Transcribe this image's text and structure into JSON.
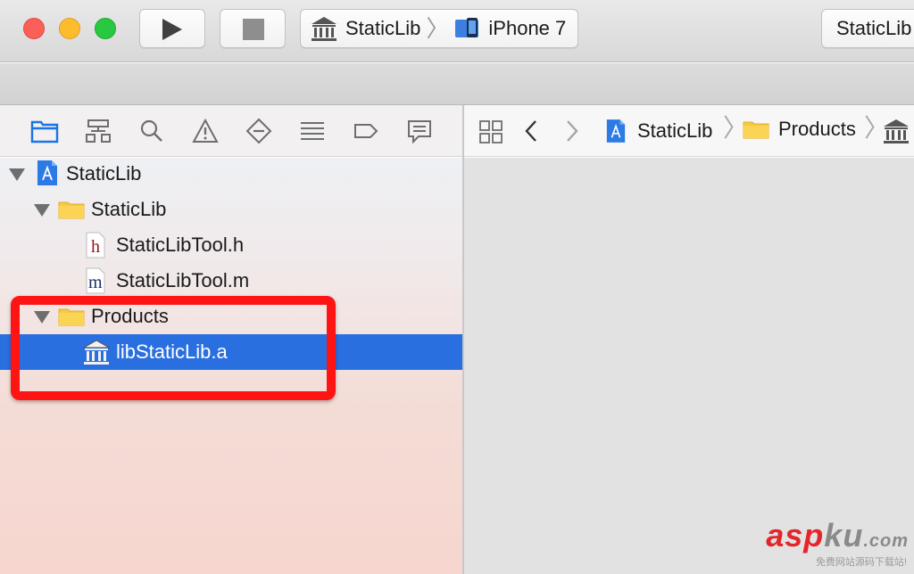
{
  "toolbar": {
    "scheme": "StaticLib",
    "device": "iPhone 7",
    "activity": "StaticLib"
  },
  "navigator_tabs": [
    {
      "name": "project-navigator-icon",
      "active": true
    },
    {
      "name": "symbol-navigator-icon"
    },
    {
      "name": "find-navigator-icon"
    },
    {
      "name": "issue-navigator-icon"
    },
    {
      "name": "test-navigator-icon"
    },
    {
      "name": "debug-navigator-icon"
    },
    {
      "name": "breakpoint-navigator-icon"
    },
    {
      "name": "report-navigator-icon"
    }
  ],
  "tree": {
    "project": "StaticLib",
    "group": "StaticLib",
    "header_file": "StaticLibTool.h",
    "impl_file": "StaticLibTool.m",
    "products_group": "Products",
    "product": "libStaticLib.a",
    "header_letter": "h",
    "impl_letter": "m"
  },
  "jumpbar": {
    "project": "StaticLib",
    "folder": "Products"
  },
  "watermark": {
    "asp": "asp",
    "ku": "ku",
    "com": ".com",
    "sub": "免费网站源码下载站!"
  },
  "colors": {
    "selection": "#2a6fe0",
    "highlight": "#ff1414",
    "folder": "#f7c940"
  }
}
